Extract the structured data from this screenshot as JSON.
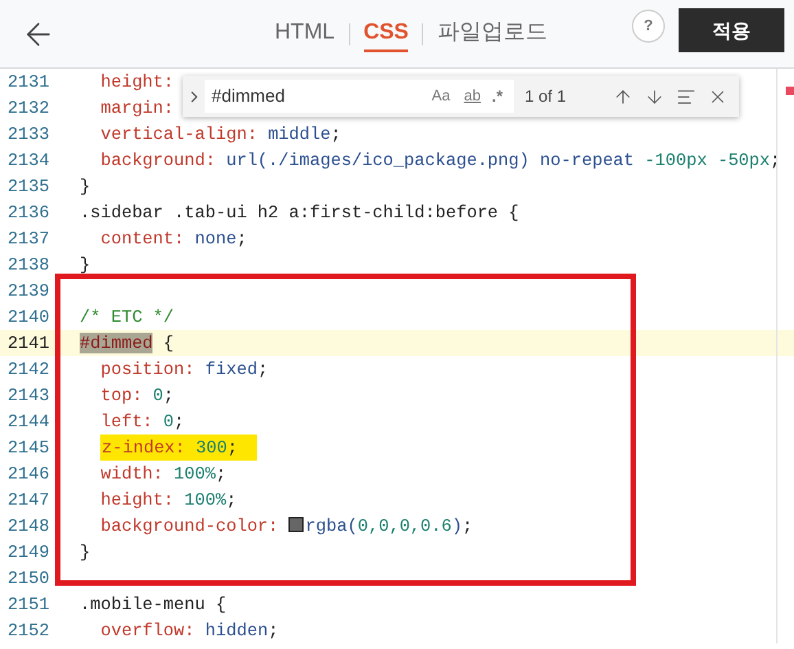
{
  "header": {
    "tabs": [
      {
        "label": "HTML",
        "selected": false
      },
      {
        "label": "CSS",
        "selected": true
      },
      {
        "label": "파일업로드",
        "selected": false
      }
    ],
    "help": "?",
    "apply_button": "적용"
  },
  "find_widget": {
    "query": "#dimmed",
    "match_case": "Aa",
    "whole_word": "ab",
    "regex": ".*",
    "result": "1 of 1"
  },
  "editor": {
    "sections": [
      {
        "kind": "plain",
        "lines": [
          {
            "number": "2131",
            "kind": "plain",
            "tokens": [
              {
                "kind": "prop",
                "text": "  height:"
              }
            ]
          },
          {
            "number": "2132",
            "kind": "plain",
            "tokens": [
              {
                "kind": "prop",
                "text": "  margin:"
              }
            ]
          },
          {
            "number": "2133",
            "kind": "plain",
            "tokens": [
              {
                "kind": "prop",
                "text": "  vertical-align: "
              },
              {
                "kind": "val",
                "text": "middle"
              },
              {
                "kind": "punc",
                "text": ";"
              }
            ]
          },
          {
            "number": "2134",
            "kind": "plain",
            "tokens": [
              {
                "kind": "prop",
                "text": "  background: "
              },
              {
                "kind": "val",
                "text": "url(./images/ico_package.png) no-repeat "
              },
              {
                "kind": "num",
                "text": "-100px -50px"
              },
              {
                "kind": "punc",
                "text": ";"
              }
            ]
          },
          {
            "number": "2135",
            "kind": "plain",
            "tokens": [
              {
                "kind": "punc",
                "text": "}"
              }
            ]
          },
          {
            "number": "2136",
            "kind": "plain",
            "tokens": [
              {
                "kind": "sel",
                "text": ".sidebar .tab-ui h2 a:first-child:before {"
              }
            ]
          },
          {
            "number": "2137",
            "kind": "plain",
            "tokens": [
              {
                "kind": "prop",
                "text": "  content: "
              },
              {
                "kind": "val",
                "text": "none"
              },
              {
                "kind": "punc",
                "text": ";"
              }
            ]
          },
          {
            "number": "2138",
            "kind": "plain",
            "tokens": [
              {
                "kind": "punc",
                "text": "}"
              }
            ]
          }
        ]
      },
      {
        "kind": "boxed",
        "lines": [
          {
            "number": "2139",
            "kind": "plain"
          },
          {
            "number": "2140",
            "kind": "plain",
            "tokens": [
              {
                "kind": "comment",
                "text": "/* ETC */"
              }
            ]
          },
          {
            "number": "2141",
            "kind": "current",
            "tokens": [
              {
                "kind": "match",
                "text": "#dimmed"
              },
              {
                "kind": "sel",
                "text": " {"
              }
            ]
          },
          {
            "number": "2142",
            "kind": "plain",
            "tokens": [
              {
                "kind": "prop",
                "text": "  position: "
              },
              {
                "kind": "val",
                "text": "fixed"
              },
              {
                "kind": "punc",
                "text": ";"
              }
            ]
          },
          {
            "number": "2143",
            "kind": "plain",
            "tokens": [
              {
                "kind": "prop",
                "text": "  top: "
              },
              {
                "kind": "num",
                "text": "0"
              },
              {
                "kind": "punc",
                "text": ";"
              }
            ]
          },
          {
            "number": "2144",
            "kind": "plain",
            "tokens": [
              {
                "kind": "prop",
                "text": "  left: "
              },
              {
                "kind": "num",
                "text": "0"
              },
              {
                "kind": "punc",
                "text": ";"
              }
            ]
          },
          {
            "number": "2145",
            "kind": "marked",
            "tokens": [
              {
                "kind": "prop",
                "text": "z-index: "
              },
              {
                "kind": "num",
                "text": "300"
              },
              {
                "kind": "punc",
                "text": ";"
              }
            ]
          },
          {
            "number": "2146",
            "kind": "plain",
            "tokens": [
              {
                "kind": "prop",
                "text": "  width: "
              },
              {
                "kind": "num",
                "text": "100%"
              },
              {
                "kind": "punc",
                "text": ";"
              }
            ]
          },
          {
            "number": "2147",
            "kind": "plain",
            "tokens": [
              {
                "kind": "prop",
                "text": "  height: "
              },
              {
                "kind": "num",
                "text": "100%"
              },
              {
                "kind": "punc",
                "text": ";"
              }
            ]
          },
          {
            "number": "2148",
            "kind": "plain",
            "tokens": [
              {
                "kind": "prop",
                "text": "  background-color: "
              },
              {
                "kind": "swatch"
              },
              {
                "kind": "val",
                "text": "rgba("
              },
              {
                "kind": "num",
                "text": "0,0,0,0.6"
              },
              {
                "kind": "val",
                "text": ")"
              },
              {
                "kind": "punc",
                "text": ";"
              }
            ]
          },
          {
            "number": "2149",
            "kind": "plain",
            "tokens": [
              {
                "kind": "punc",
                "text": "}"
              }
            ]
          },
          {
            "number": "2150",
            "kind": "plain"
          }
        ]
      },
      {
        "kind": "plain",
        "lines": [
          {
            "number": "2151",
            "kind": "plain",
            "tokens": [
              {
                "kind": "sel",
                "text": ".mobile-menu {"
              }
            ]
          },
          {
            "number": "2152",
            "kind": "plain",
            "tokens": [
              {
                "kind": "prop",
                "text": "  overflow: "
              },
              {
                "kind": "val",
                "text": "hidden"
              },
              {
                "kind": "punc",
                "text": ";"
              }
            ]
          }
        ]
      }
    ]
  }
}
